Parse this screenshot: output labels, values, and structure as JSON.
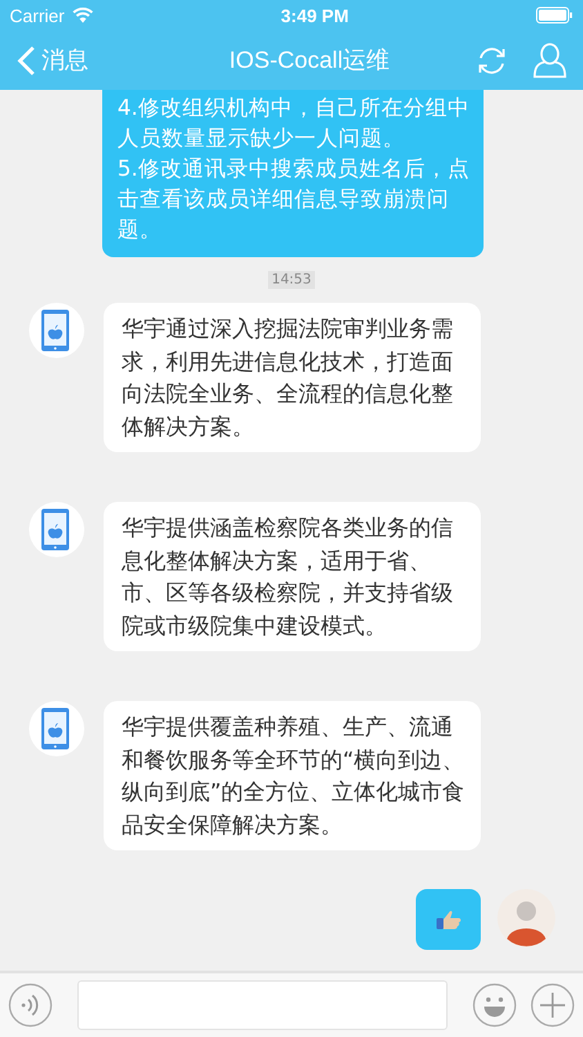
{
  "status_bar": {
    "carrier": "Carrier",
    "time": "3:49 PM"
  },
  "nav": {
    "back": "消息",
    "title": "IOS-Cocall运维"
  },
  "messages": [
    {
      "kind": "sent_text",
      "lines": [
        "4.修改组织机构中，自己所在分组中",
        "人员数量显示缺少一人问题。",
        "5.修改通讯录中搜索成员姓名后，点",
        "击查看该成员详细信息导致崩溃问",
        "题。"
      ]
    },
    {
      "kind": "time",
      "text": "14:53"
    },
    {
      "kind": "received_text",
      "text": "华宇通过深入挖掘法院审判业务需求，利用先进信息化技术，打造面向法院全业务、全流程的信息化整体解决方案。"
    },
    {
      "kind": "received_text",
      "text": "华宇提供涵盖检察院各类业务的信息化整体解决方案，适用于省、市、区等各级检察院，并支持省级院或市级院集中建设模式。"
    },
    {
      "kind": "received_text",
      "text": "华宇提供覆盖种养殖、生产、流通和餐饮服务等全环节的“横向到边、纵向到底”的全方位、立体化城市食品安全保障解决方案。"
    },
    {
      "kind": "sent_thumb"
    }
  ]
}
